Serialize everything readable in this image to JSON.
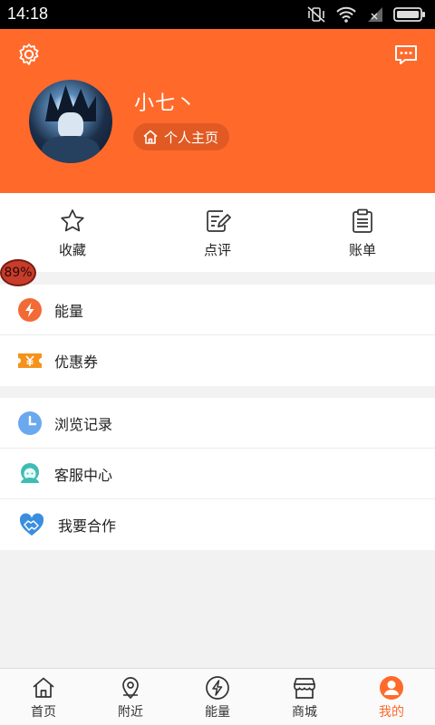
{
  "status_bar": {
    "time": "14:18",
    "icons": [
      "vibrate-off-icon",
      "wifi-icon",
      "signal-icon",
      "battery-icon"
    ]
  },
  "header": {
    "background": "#ff6a2b",
    "settings_icon": "gear-icon",
    "message_icon": "message-icon",
    "username": "小七丶",
    "home_link": "个人主页"
  },
  "quick_actions": [
    {
      "label": "收藏",
      "icon": "star-icon"
    },
    {
      "label": "点评",
      "icon": "edit-icon"
    },
    {
      "label": "账单",
      "icon": "clipboard-icon"
    }
  ],
  "menu_group_1": [
    {
      "label": "能量",
      "icon": "energy-icon",
      "color": "#f26a36"
    },
    {
      "label": "优惠券",
      "icon": "coupon-icon",
      "color": "#f5921e"
    }
  ],
  "menu_group_2": [
    {
      "label": "浏览记录",
      "icon": "clock-icon",
      "color": "#6aa8ef"
    },
    {
      "label": "客服中心",
      "icon": "customer-service-icon",
      "color": "#3dbdb4"
    },
    {
      "label": "我要合作",
      "icon": "handshake-icon",
      "color": "#3a8ee0"
    }
  ],
  "floating_badge": {
    "text": "89%"
  },
  "tabbar": {
    "accent": "#ff6a2b",
    "items": [
      {
        "label": "首页",
        "icon": "home-icon",
        "active": false
      },
      {
        "label": "附近",
        "icon": "location-icon",
        "active": false
      },
      {
        "label": "能量",
        "icon": "energy-icon",
        "active": false
      },
      {
        "label": "商城",
        "icon": "store-icon",
        "active": false
      },
      {
        "label": "我的",
        "icon": "profile-icon",
        "active": true
      }
    ]
  }
}
